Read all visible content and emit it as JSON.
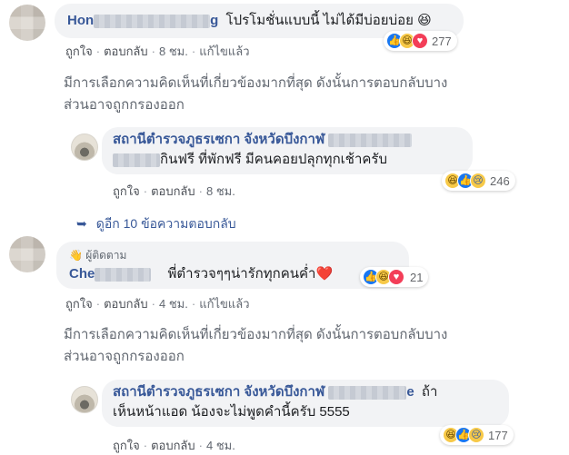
{
  "comments": [
    {
      "author_visible": "Hon",
      "author_tail": "g",
      "text": "โปรโมชั่นแบบนี้ ไม่ได้มีบ่อยบ่อย 😆",
      "actions": {
        "like": "ถูกใจ",
        "reply": "ตอบกลับ",
        "time": "8 ชม.",
        "edited": "แก้ไขแล้ว"
      },
      "reaction_count": "277",
      "filter_notice": "มีการเลือกความคิดเห็นที่เกี่ยวข้องมากที่สุด ดังนั้นการตอบกลับบาง ส่วนอาจถูกกรองออก",
      "filter_line1": "มีการเลือกความคิดเห็นที่เกี่ยวข้องมากที่สุด ดังนั้นการตอบกลับบาง",
      "filter_line2": "ส่วนอาจถูกกรองออก",
      "reply": {
        "author": "สถานีตำรวจภูธรเซกา จังหวัดบึงกาฬ",
        "text": "กินฟรี ที่พักฟรี มีคนคอยปลุกทุกเช้าครับ",
        "actions": {
          "like": "ถูกใจ",
          "reply": "ตอบกลับ",
          "time": "8 ชม."
        },
        "reaction_count": "246"
      },
      "more_replies": "ดูอีก 10 ข้อความตอบกลับ"
    },
    {
      "badge": "ผู้ติดตาม",
      "author_visible": "Che",
      "text": "พี่ตำรวจๆๆน่ารักทุกคนค่ำ❤️",
      "actions": {
        "like": "ถูกใจ",
        "reply": "ตอบกลับ",
        "time": "4 ชม.",
        "edited": "แก้ไขแล้ว"
      },
      "reaction_count": "21",
      "filter_line1": "มีการเลือกความคิดเห็นที่เกี่ยวข้องมากที่สุด ดังนั้นการตอบกลับบาง",
      "filter_line2": "ส่วนอาจถูกกรองออก",
      "reply": {
        "author": "สถานีตำรวจภูธรเซกา จังหวัดบึงกาฬ",
        "tail": "e",
        "line1_end": "ถ้า",
        "line2": "เห็นหน้าแอด น้องจะไม่พูดคำนี้ครับ 5555",
        "actions": {
          "like": "ถูกใจ",
          "reply": "ตอบกลับ",
          "time": "4 ชม."
        },
        "reaction_count": "177"
      }
    }
  ],
  "colors": {
    "link": "#385898",
    "meta": "#616770",
    "bubble": "#f2f3f5",
    "like": "#1877f2"
  },
  "icons": [
    "like-reaction-icon",
    "haha-reaction-icon",
    "love-reaction-icon",
    "sad-reaction-icon",
    "reply-arrow-icon",
    "wave-hand-icon"
  ]
}
